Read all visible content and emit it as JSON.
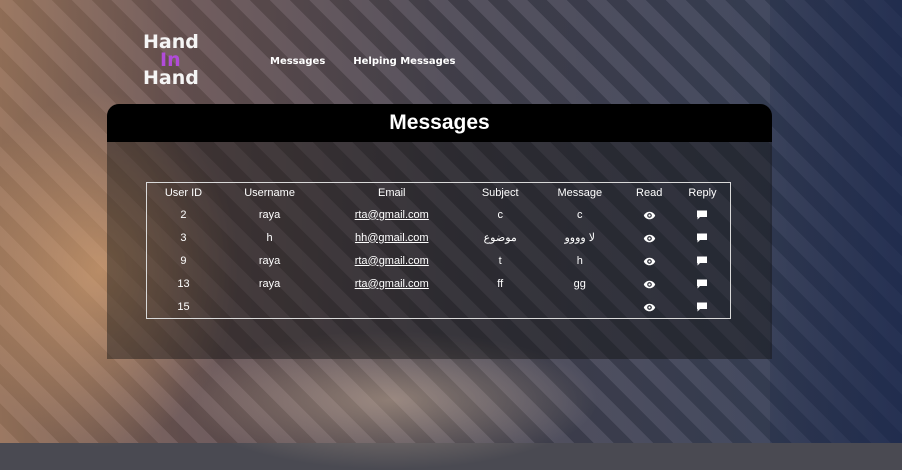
{
  "brand": {
    "line1": "Hand",
    "line2": "In",
    "line3": "Hand",
    "accent_color": "#b14bd9"
  },
  "nav": {
    "items": [
      {
        "label": "Messages"
      },
      {
        "label": "Helping Messages"
      }
    ]
  },
  "panel": {
    "title": "Messages"
  },
  "table": {
    "headers": [
      "User ID",
      "Username",
      "Email",
      "Subject",
      "Message",
      "Read",
      "Reply"
    ],
    "read_icon": "eye-icon",
    "reply_icon": "comment-icon",
    "rows": [
      {
        "user_id": "2",
        "username": "raya",
        "email": "rta@gmail.com",
        "subject": "c",
        "message": "c"
      },
      {
        "user_id": "3",
        "username": "h",
        "email": "hh@gmail.com",
        "subject": "موضوع",
        "message": "لا وووو"
      },
      {
        "user_id": "9",
        "username": "raya",
        "email": "rta@gmail.com",
        "subject": "t",
        "message": "h"
      },
      {
        "user_id": "13",
        "username": "raya",
        "email": "rta@gmail.com",
        "subject": "ff",
        "message": "gg"
      },
      {
        "user_id": "15",
        "username": "",
        "email": "",
        "subject": "",
        "message": ""
      }
    ]
  }
}
